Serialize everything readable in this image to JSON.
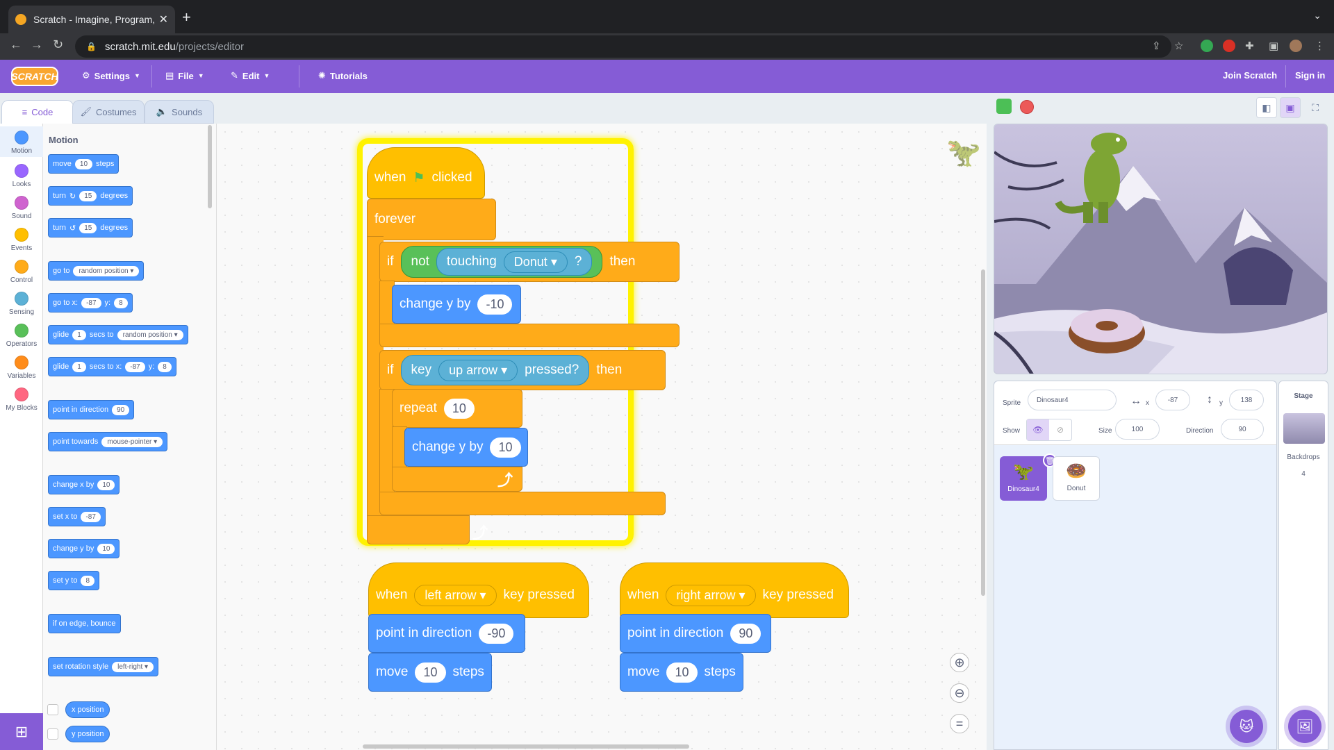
{
  "browser": {
    "tab_title": "Scratch - Imagine, Program, Sh",
    "url_host": "scratch.mit.edu",
    "url_path": "/projects/editor"
  },
  "menu": {
    "logo": "SCRATCH",
    "settings": "Settings",
    "file": "File",
    "edit": "Edit",
    "tutorials": "Tutorials",
    "join": "Join Scratch",
    "signin": "Sign in"
  },
  "editor_tabs": {
    "code": "Code",
    "costumes": "Costumes",
    "sounds": "Sounds"
  },
  "categories": [
    {
      "label": "Motion",
      "color": "#4c97ff"
    },
    {
      "label": "Looks",
      "color": "#9966ff"
    },
    {
      "label": "Sound",
      "color": "#cf63cf"
    },
    {
      "label": "Events",
      "color": "#ffbf00"
    },
    {
      "label": "Control",
      "color": "#ffab19"
    },
    {
      "label": "Sensing",
      "color": "#5cb1d6"
    },
    {
      "label": "Operators",
      "color": "#59c059"
    },
    {
      "label": "Variables",
      "color": "#ff8c1a"
    },
    {
      "label": "My Blocks",
      "color": "#ff6680"
    }
  ],
  "palette": {
    "title": "Motion",
    "move": {
      "a": "move",
      "v": "10",
      "b": "steps"
    },
    "turn_right": {
      "a": "turn",
      "icon": "↻",
      "v": "15",
      "b": "degrees"
    },
    "turn_left": {
      "a": "turn",
      "icon": "↺",
      "v": "15",
      "b": "degrees"
    },
    "goto": {
      "a": "go to",
      "dd": "random position"
    },
    "gotoxy": {
      "a": "go to x:",
      "x": "-87",
      "b": "y:",
      "y": "8"
    },
    "glide_to": {
      "a": "glide",
      "v": "1",
      "b": "secs to",
      "dd": "random position"
    },
    "glide_xy": {
      "a": "glide",
      "v": "1",
      "b": "secs to x:",
      "x": "-87",
      "c": "y:",
      "y": "8"
    },
    "point_dir": {
      "a": "point in direction",
      "v": "90"
    },
    "point_towards": {
      "a": "point towards",
      "dd": "mouse-pointer"
    },
    "change_x": {
      "a": "change x by",
      "v": "10"
    },
    "set_x": {
      "a": "set x to",
      "v": "-87"
    },
    "change_y": {
      "a": "change y by",
      "v": "10"
    },
    "set_y": {
      "a": "set y to",
      "v": "8"
    },
    "bounce": "if on edge, bounce",
    "rot_style": {
      "a": "set rotation style",
      "dd": "left-right"
    },
    "x_position": "x position",
    "y_position": "y position"
  },
  "script1": {
    "when": "when",
    "clicked": "clicked",
    "forever": "forever",
    "if1": "if",
    "not": "not",
    "touching": "touching",
    "touch_target": "Donut",
    "q": "?",
    "then1": "then",
    "change_y1": "change y by",
    "change_y1_v": "-10",
    "if2": "if",
    "key": "key",
    "key_target": "up arrow",
    "pressed": "pressed?",
    "then2": "then",
    "repeat": "repeat",
    "repeat_v": "10",
    "change_y2": "change y by",
    "change_y2_v": "10"
  },
  "script2": {
    "when": "when",
    "key": "left arrow",
    "pressed": "key pressed",
    "point": "point in direction",
    "point_v": "-90",
    "move": "move",
    "move_v": "10",
    "steps": "steps"
  },
  "script3": {
    "when": "when",
    "key": "right arrow",
    "pressed": "key pressed",
    "point": "point in direction",
    "point_v": "90",
    "move": "move",
    "move_v": "10",
    "steps": "steps"
  },
  "sprite_info": {
    "sprite_label": "Sprite",
    "sprite_name": "Dinosaur4",
    "x_label": "x",
    "x_value": "-87",
    "y_label": "y",
    "y_value": "138",
    "show_label": "Show",
    "size_label": "Size",
    "size_value": "100",
    "direction_label": "Direction",
    "direction_value": "90"
  },
  "sprites": [
    {
      "name": "Dinosaur4",
      "selected": true
    },
    {
      "name": "Donut",
      "selected": false
    }
  ],
  "stage_pane": {
    "title": "Stage",
    "backdrops_label": "Backdrops",
    "backdrops_count": "4"
  }
}
